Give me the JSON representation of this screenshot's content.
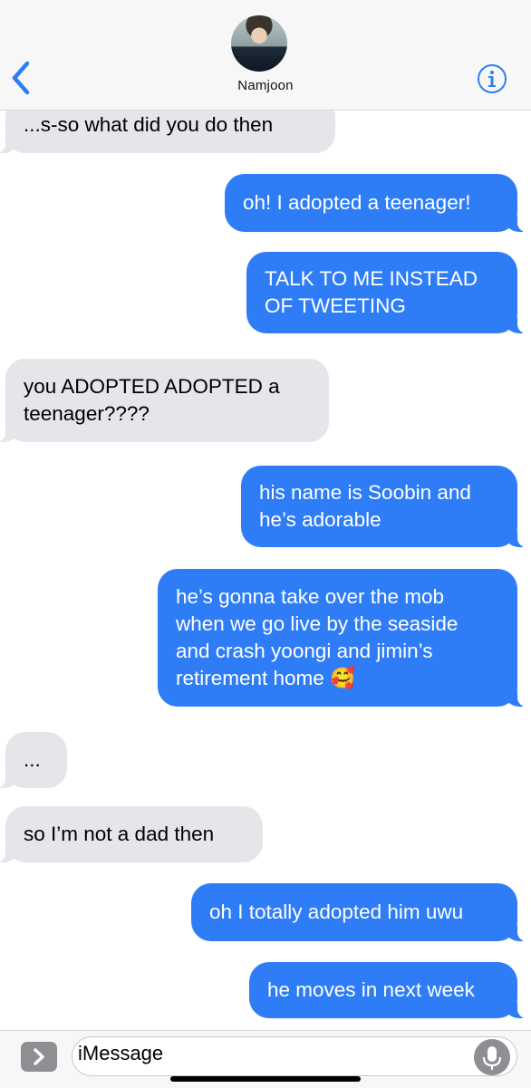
{
  "header": {
    "contact_name": "Namjoon",
    "back_icon": "chevron-left-icon",
    "info_icon": "info-circle-icon",
    "accent_color": "#2f7df6"
  },
  "messages": [
    {
      "side": "in",
      "text": "...s-so what did you do then"
    },
    {
      "side": "out",
      "text": "oh! I adopted a teenager!"
    },
    {
      "side": "out",
      "text": "TALK TO ME INSTEAD OF TWEETING",
      "lines": [
        "TALK TO ME INSTEAD",
        "OF TWEETING"
      ]
    },
    {
      "side": "in",
      "text": "you ADOPTED ADOPTED a teenager????",
      "lines": [
        "you ADOPTED ADOPTED a",
        "teenager????"
      ]
    },
    {
      "side": "out",
      "text": "his name is Soobin and he’s adorable",
      "lines": [
        "his name is Soobin and",
        "he’s adorable"
      ]
    },
    {
      "side": "out",
      "text": "he’s gonna take over the mob when we go live by the seaside and crash yoongi and jimin’s retirement home 🥰",
      "lines": [
        "he’s gonna take over the mob",
        "when we go live by the seaside",
        "and crash yoongi and jimin’s",
        "retirement home 🥰"
      ]
    },
    {
      "side": "in",
      "text": "..."
    },
    {
      "side": "in",
      "text": "so I’m not a dad then"
    },
    {
      "side": "out",
      "text": "oh I totally adopted him uwu"
    },
    {
      "side": "out",
      "text": "he moves in next week"
    }
  ],
  "input": {
    "placeholder": "iMessage",
    "apps_icon": "chevron-right-icon",
    "mic_icon": "microphone-icon"
  },
  "colors": {
    "incoming_bubble": "#e5e5ea",
    "outgoing_bubble": "#2f7df6"
  }
}
